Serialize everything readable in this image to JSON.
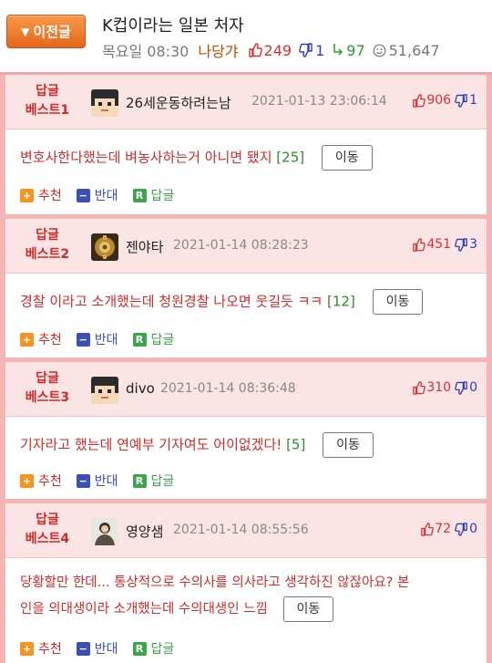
{
  "header": {
    "prev_label": "이전글",
    "title": "K컵이라는 일본 처자",
    "day_time": "목요일 08:30",
    "author": "나당갸",
    "up_count": "249",
    "down_count": "1",
    "reply_count": "97",
    "view_count": "51,647"
  },
  "comments": [
    {
      "badge_line1": "답글",
      "badge_line2": "베스트1",
      "nickname": "26세운동하려는남",
      "date": "2021-01-13 23:06:14",
      "up": "906",
      "down": "1",
      "text": "변호사한다했는데 벼농사하는거 아니면 됐지",
      "reply_count": "[25]",
      "move_label": "이동",
      "recommend_label": "추천",
      "oppose_label": "반대",
      "reply_label": "답글"
    },
    {
      "badge_line1": "답글",
      "badge_line2": "베스트2",
      "nickname": "젠야타",
      "date": "2021-01-14 08:28:23",
      "up": "451",
      "down": "3",
      "text": "경찰 이라고 소개했는데 청원경찰 나오면 웃길듯 ㅋㅋ",
      "reply_count": "[12]",
      "move_label": "이동",
      "recommend_label": "추천",
      "oppose_label": "반대",
      "reply_label": "답글"
    },
    {
      "badge_line1": "답글",
      "badge_line2": "베스트3",
      "nickname": "divo",
      "date": "2021-01-14 08:36:48",
      "up": "310",
      "down": "0",
      "text": "기자라고 했는데 연예부 기자여도 어이없겠다!",
      "reply_count": "[5]",
      "move_label": "이동",
      "recommend_label": "추천",
      "oppose_label": "반대",
      "reply_label": "답글"
    },
    {
      "badge_line1": "답글",
      "badge_line2": "베스트4",
      "nickname": "영양샘",
      "date": "2021-01-14 08:55:56",
      "up": "72",
      "down": "0",
      "text_line1": "당황할만 한데... 통상적으로 수의사를 의사라고 생각하진 않잖아요? 본",
      "text_line2": "인을 의대생이라 소개했는데 수의대생인 느낌",
      "move_label": "이동",
      "recommend_label": "추천",
      "oppose_label": "반대",
      "reply_label": "답글"
    }
  ]
}
